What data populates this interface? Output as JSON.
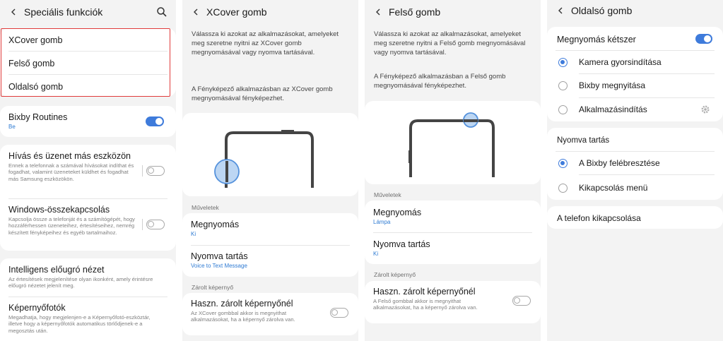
{
  "screen1": {
    "title": "Speciális funkciók",
    "highlighted_items": [
      "XCover gomb",
      "Felső gomb",
      "Oldalsó gomb"
    ],
    "bixby": {
      "title": "Bixby Routines",
      "status": "Be"
    },
    "calls": {
      "title": "Hívás és üzenet más eszközön",
      "desc": "Ennek a telefonnak a számával hívásokat indíthat és fogadhat, valamint üzeneteket küldhet és fogadhat más Samsung eszközökön."
    },
    "windows": {
      "title": "Windows-összekapcsolás",
      "desc": "Kapcsolja össze a telefonját és a számítógépét, hogy hozzáférhessen üzeneteihez, értesítéseihez, nemrég készített fényképeihez és egyéb tartalmaihoz."
    },
    "smart_view": {
      "title": "Intelligens előugró nézet",
      "desc": "Az értesítések megjelenítése olyan ikonként, amely érintésre előugró nézetet jelenít meg."
    },
    "screenshots": {
      "title": "Képernyőfotók",
      "desc": "Megadhatja, hogy megjelenjen-e a Képernyőfotó-eszköztár, illetve hogy a képernyőfotók automatikus törlődjenek-e a megosztás után."
    }
  },
  "screen2": {
    "title": "XCover gomb",
    "intro1": "Válassza ki azokat az alkalmazásokat, amelyeket meg szeretne nyitni az XCover gomb megnyomásával vagy nyomva tartásával.",
    "intro2": "A Fényképező alkalmazásban az XCover gomb megnyomásával fényképezhet.",
    "section_actions": "Műveletek",
    "press": {
      "title": "Megnyomás",
      "value": "Ki"
    },
    "hold": {
      "title": "Nyomva tartás",
      "value": "Voice to Text Message"
    },
    "section_lock": "Zárolt képernyő",
    "lock": {
      "title": "Haszn. zárolt képernyőnél",
      "desc": "Az XCover gombbal akkor is megnyithat alkalmazásokat, ha a képernyő zárolva van."
    }
  },
  "screen3": {
    "title": "Felső gomb",
    "intro1": "Válassza ki azokat az alkalmazásokat, amelyeket meg szeretne nyitni a Felső gomb megnyomásával vagy nyomva tartásával.",
    "intro2": "A Fényképező alkalmazásban a Felső gomb megnyomásával fényképezhet.",
    "section_actions": "Műveletek",
    "press": {
      "title": "Megnyomás",
      "value": "Lámpa"
    },
    "hold": {
      "title": "Nyomva tartás",
      "value": "Ki"
    },
    "section_lock": "Zárolt képernyő",
    "lock": {
      "title": "Haszn. zárolt képernyőnél",
      "desc": "A Felső gombbal akkor is megnyithat alkalmazásokat, ha a képernyő zárolva van."
    }
  },
  "screen4": {
    "title": "Oldalsó gomb",
    "double_press": "Megnyomás kétszer",
    "options_double": [
      "Kamera gyorsindítása",
      "Bixby megnyitása",
      "Alkalmazásindítás"
    ],
    "hold_header": "Nyomva tartás",
    "options_hold": [
      "A Bixby felébresztése",
      "Kikapcsolás menü"
    ],
    "power_off": "A telefon kikapcsolása"
  },
  "colors": {
    "accent": "#3e7bdb",
    "highlight_border": "#e03b3b",
    "background": "#f3f3f3"
  }
}
